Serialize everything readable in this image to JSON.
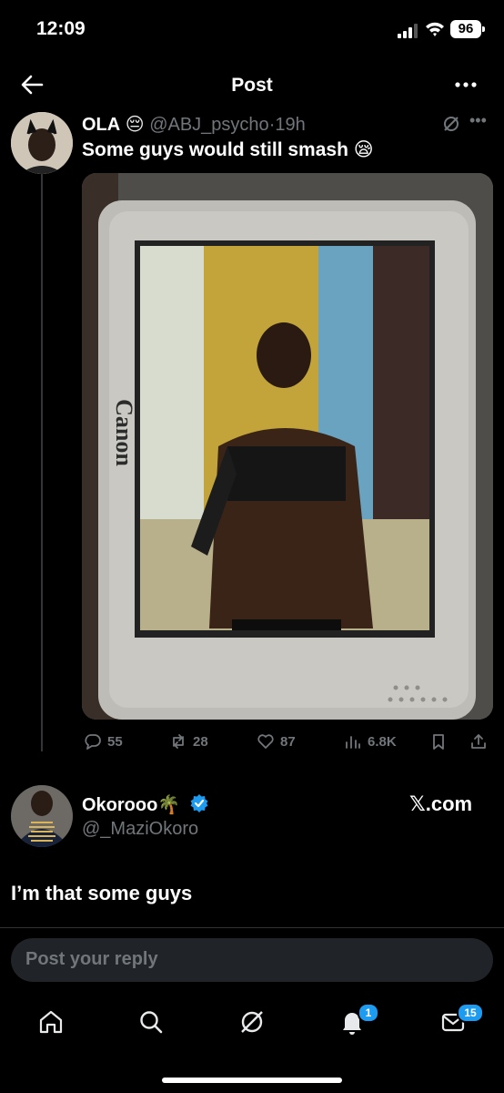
{
  "status_bar": {
    "time": "12:09",
    "battery": "96"
  },
  "nav": {
    "title": "Post"
  },
  "post": {
    "author_name": "OLA",
    "author_emoji": "😔",
    "handle": "@ABJ_psycho",
    "separator": "·",
    "time_ago": "19h",
    "text": "Some guys would still smash",
    "text_emoji": "😪",
    "image_brand_text": "Canon",
    "stats": {
      "replies": "55",
      "reposts": "28",
      "likes": "87",
      "views": "6.8K"
    }
  },
  "quote": {
    "author_name": "Okorooo",
    "author_emoji": "🌴",
    "handle": "@_MaziOkoro",
    "source": "𝕏.com",
    "text": "I’m that some guys"
  },
  "reply": {
    "placeholder": "Post your reply"
  },
  "tabbar": {
    "notifications_count": "1",
    "messages_count": "15"
  },
  "colors": {
    "accent": "#1d9bf0",
    "muted": "#71767b",
    "background": "#000000"
  }
}
